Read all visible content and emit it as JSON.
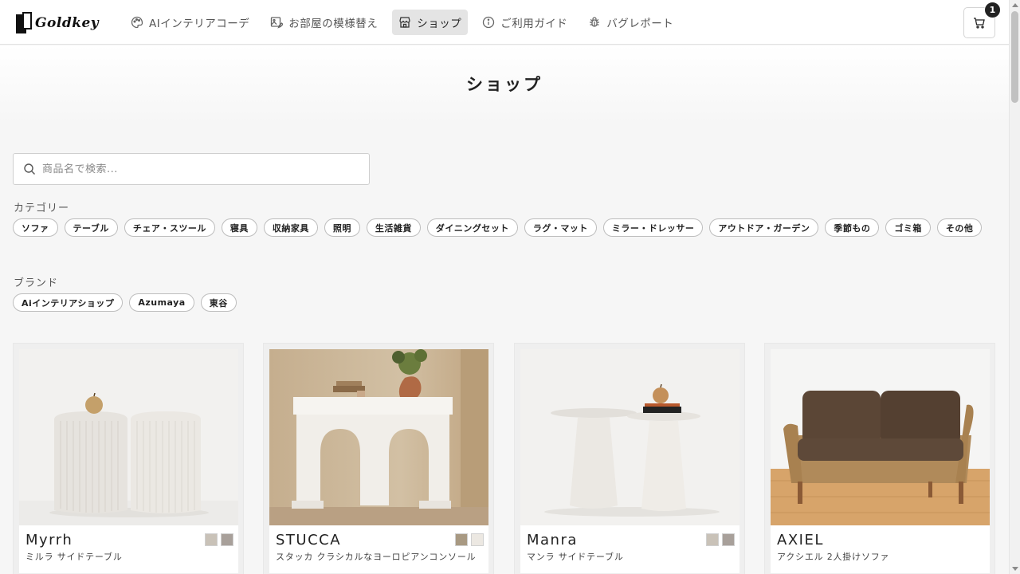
{
  "brand": {
    "logo_text": "Goldkey"
  },
  "nav": {
    "items": [
      {
        "label": "AIインテリアコーデ",
        "icon": "palette-icon"
      },
      {
        "label": "お部屋の模様替え",
        "icon": "image-edit-icon"
      },
      {
        "label": "ショップ",
        "icon": "store-icon",
        "active": true
      },
      {
        "label": "ご利用ガイド",
        "icon": "info-icon"
      },
      {
        "label": "バグレポート",
        "icon": "bug-icon"
      }
    ]
  },
  "cart": {
    "count": "1",
    "icon": "cart-icon"
  },
  "page": {
    "title": "ショップ"
  },
  "search": {
    "placeholder": "商品名で検索...",
    "value": ""
  },
  "filters": {
    "category_label": "カテゴリー",
    "categories": [
      "ソファ",
      "テーブル",
      "チェア・スツール",
      "寝具",
      "収納家具",
      "照明",
      "生活雑貨",
      "ダイニングセット",
      "ラグ・マット",
      "ミラー・ドレッサー",
      "アウトドア・ガーデン",
      "季節もの",
      "ゴミ箱",
      "その他"
    ],
    "brand_label": "ブランド",
    "brands": [
      "Aiインテリアショップ",
      "Azumaya",
      "東谷"
    ]
  },
  "products": [
    {
      "name": "Myrrh",
      "subtitle": "ミルラ サイドテーブル",
      "swatches": [
        "#c9c2b8",
        "#a8a09a"
      ]
    },
    {
      "name": "STUCCA",
      "subtitle": "スタッカ クラシカルなヨーロピアンコンソール",
      "swatches": [
        "#a89982",
        "#ece8e2"
      ]
    },
    {
      "name": "Manra",
      "subtitle": "マンラ サイドテーブル",
      "swatches": [
        "#c9c2b8",
        "#a8a09a"
      ]
    },
    {
      "name": "AXIEL",
      "subtitle": "アクシエル 2人掛けソファ",
      "swatches": []
    }
  ]
}
